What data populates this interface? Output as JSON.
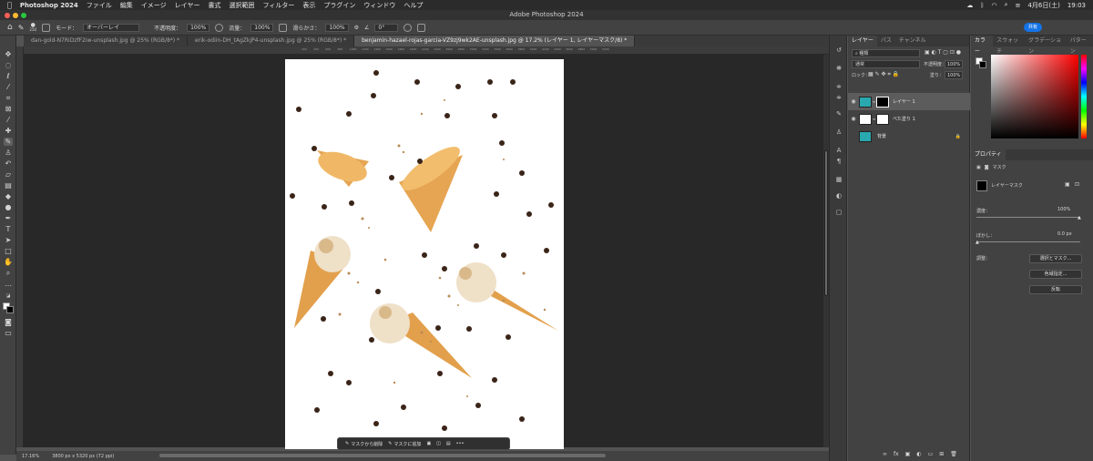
{
  "menubar": {
    "app": "Photoshop 2024",
    "items": [
      "ファイル",
      "編集",
      "イメージ",
      "レイヤー",
      "書式",
      "選択範囲",
      "フィルター",
      "表示",
      "プラグイン",
      "ウィンドウ",
      "ヘルプ"
    ],
    "date": "4月6日(土)",
    "time": "19:03"
  },
  "window": {
    "title": "Adobe Photoshop 2024",
    "share": "共有"
  },
  "options": {
    "brush_size": "250",
    "mode_label": "モード：",
    "mode_value": "オーバーレイ",
    "opacity_label": "不透明度：",
    "opacity_value": "100%",
    "flow_label": "流量：",
    "flow_value": "100%",
    "smoothing_label": "滑らかさ：",
    "smoothing_value": "100%",
    "angle_value": "0°"
  },
  "tabs": [
    {
      "label": "dan-gold-N7RiDzfF2iw-unsplash.jpg @ 25% (RGB/8*) *"
    },
    {
      "label": "erik-odiin-DH_tAgZkjP4-unsplash.jpg @ 25% (RGB/8*) *"
    },
    {
      "label": "benjamin-hazael-rojas-garcia-VZ9zj9wk2AE-unsplash.jpg @ 17.2% (レイヤー 1, レイヤーマスク/8) *"
    }
  ],
  "ruler_ticks": [
    "200",
    "400",
    "600",
    "800",
    "1000",
    "1200",
    "1400",
    "1600",
    "1800",
    "2000",
    "2200",
    "2400",
    "2600",
    "2800",
    "3000",
    "3200",
    "3400",
    "3600",
    "3800",
    "4000",
    "4200",
    "4400",
    "4600",
    "4800",
    "5000",
    "5200"
  ],
  "taskbar": {
    "remove": "マスクから削除",
    "add": "マスクに追加",
    "more": "•••"
  },
  "status": {
    "zoom": "17.16%",
    "size": "3800 px x 5320 px (72 ppi)"
  },
  "layers_panel": {
    "tabs": [
      "レイヤー",
      "パス",
      "チャンネル"
    ],
    "filter": "種類",
    "blend": "通常",
    "opacity_label": "不透明度：",
    "opacity": "100%",
    "lock_label": "ロック：",
    "fill_label": "塗り：",
    "fill": "100%",
    "layers": [
      {
        "name": "レイヤー 1"
      },
      {
        "name": "べた塗り 1"
      },
      {
        "name": "背景"
      }
    ],
    "footer": "fx"
  },
  "color_panel": {
    "tabs": [
      "カラー",
      "スウォッチ",
      "グラデーション",
      "パターン"
    ]
  },
  "properties": {
    "title": "プロパティ",
    "section": "マスク",
    "mask_name": "レイヤーマスク",
    "density_label": "濃度：",
    "density": "100%",
    "feather_label": "ぼかし：",
    "feather": "0.0 px",
    "adjust_label": "調整：",
    "buttons": [
      "選択とマスク...",
      "色域指定...",
      "反転"
    ]
  },
  "colors": {
    "accent": "#1473e6",
    "bg": "#535353",
    "panel": "#424242"
  }
}
